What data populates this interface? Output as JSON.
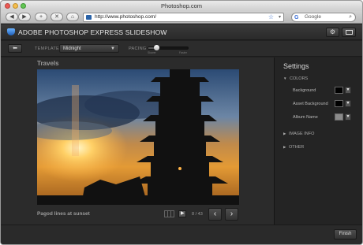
{
  "browser": {
    "window_title": "Photoshop.com",
    "url": "http://www.photoshop.com/",
    "search_placeholder": "Google",
    "rss_label": "RSS"
  },
  "app": {
    "title": "ADOBE PHOTOSHOP EXPRESS SLIDESHOW",
    "template_label": "TEMPLATE",
    "template_value": "Midnight",
    "pacing_label": "PACING",
    "pacing_slow": "Slower",
    "pacing_fast": "Faster",
    "pacing_level": 0.2
  },
  "slideshow": {
    "album_title": "Travels",
    "caption": "Pagod lines at sunset",
    "counter": "8 / 43"
  },
  "settings": {
    "title": "Settings",
    "colors_section": "COLORS",
    "rows": [
      {
        "label": "Background",
        "color": "#000000"
      },
      {
        "label": "Asset Background",
        "color": "#000000"
      },
      {
        "label": "Album Name",
        "color": "#8a8a8a"
      }
    ],
    "image_info_section": "IMAGE INFO",
    "other_section": "OTHER"
  },
  "footer": {
    "finish_label": "Finish"
  }
}
